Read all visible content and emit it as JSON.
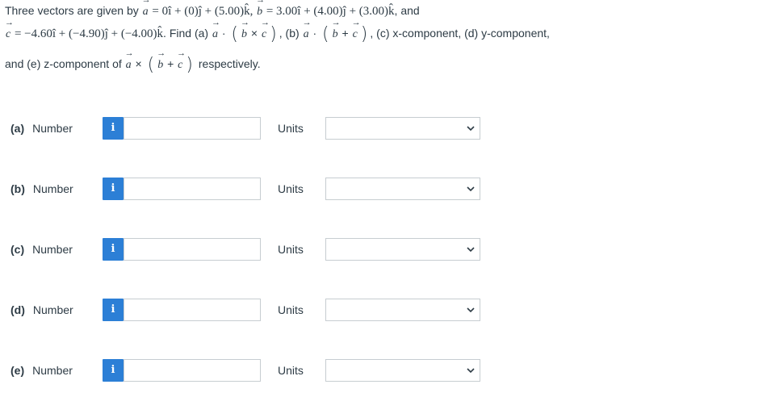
{
  "question": {
    "line1": {
      "intro": "Three vectors are given by ",
      "a_symbol": "a",
      "a_eq": " = 0î + (0)ĵ + (5.00)k̂, ",
      "b_symbol": "b",
      "b_eq": " = 3.00î + (4.00)ĵ + (3.00)k̂",
      "and_word": ", and"
    },
    "line2": {
      "c_symbol": "c",
      "c_eq": " = −4.60î + (−4.90)ĵ + (−4.00)k̂",
      "find_text": ". Find (a) ",
      "a_symbol": "a",
      "dot": " · ",
      "b_symbol": "b",
      "cross": " × ",
      "part_b": ", (b) ",
      "a2_symbol": "a",
      "dot2": " · ",
      "b2_symbol": "b",
      "plus": " + ",
      "c2_symbol": "c",
      "tail": ", (c) x-component, (d) y-component,"
    },
    "line3": {
      "lead": "and (e) z-component of ",
      "a_symbol": "a",
      "cross": " × ",
      "b_symbol": "b",
      "plus": " + ",
      "c_symbol": "c",
      "tail": " respectively."
    }
  },
  "answers": [
    {
      "part": "(a)",
      "label": "Number",
      "info": "i",
      "value": "",
      "units_label": "Units",
      "units_selected": ""
    },
    {
      "part": "(b)",
      "label": "Number",
      "info": "i",
      "value": "",
      "units_label": "Units",
      "units_selected": ""
    },
    {
      "part": "(c)",
      "label": "Number",
      "info": "i",
      "value": "",
      "units_label": "Units",
      "units_selected": ""
    },
    {
      "part": "(d)",
      "label": "Number",
      "info": "i",
      "value": "",
      "units_label": "Units",
      "units_selected": ""
    },
    {
      "part": "(e)",
      "label": "Number",
      "info": "i",
      "value": "",
      "units_label": "Units",
      "units_selected": ""
    }
  ],
  "icons": {
    "info": "info-icon",
    "dropdown": "chevron-down-icon"
  },
  "colors": {
    "text": "#2d3b45",
    "info_button": "#2c7fd6",
    "input_border": "#c7cdd1"
  }
}
